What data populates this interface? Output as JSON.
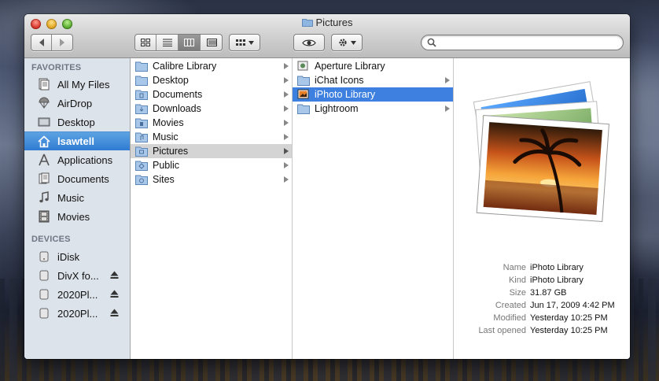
{
  "window": {
    "title": "Pictures"
  },
  "toolbar": {
    "view_modes": [
      "icon-view",
      "list-view",
      "column-view",
      "coverflow-view"
    ],
    "arrange_label": "arrange",
    "search": {
      "value": "",
      "placeholder": ""
    }
  },
  "sidebar": {
    "favorites_header": "FAVORITES",
    "favorites": [
      {
        "label": "All My Files",
        "icon": "all-files-icon"
      },
      {
        "label": "AirDrop",
        "icon": "airdrop-icon"
      },
      {
        "label": "Desktop",
        "icon": "desktop-icon"
      },
      {
        "label": "lsawtell",
        "icon": "home-icon",
        "selected": true
      },
      {
        "label": "Applications",
        "icon": "applications-icon"
      },
      {
        "label": "Documents",
        "icon": "documents-icon"
      },
      {
        "label": "Music",
        "icon": "music-icon"
      },
      {
        "label": "Movies",
        "icon": "movies-icon"
      }
    ],
    "devices_header": "DEVICES",
    "devices": [
      {
        "label": "iDisk",
        "icon": "idisk-icon",
        "eject": false
      },
      {
        "label": "DivX fo...",
        "icon": "disk-icon",
        "eject": true
      },
      {
        "label": "2020Pl...",
        "icon": "disk-icon",
        "eject": true
      },
      {
        "label": "2020Pl...",
        "icon": "disk-icon",
        "eject": true
      }
    ]
  },
  "column1": {
    "items": [
      {
        "label": "Calibre Library"
      },
      {
        "label": "Desktop"
      },
      {
        "label": "Documents"
      },
      {
        "label": "Downloads"
      },
      {
        "label": "Movies"
      },
      {
        "label": "Music"
      },
      {
        "label": "Pictures",
        "selected": true
      },
      {
        "label": "Public"
      },
      {
        "label": "Sites"
      }
    ]
  },
  "column2": {
    "items": [
      {
        "label": "Aperture Library",
        "arrow": false
      },
      {
        "label": "iChat Icons",
        "arrow": true
      },
      {
        "label": "iPhoto Library",
        "arrow": false,
        "selected": true
      },
      {
        "label": "Lightroom",
        "arrow": true
      }
    ]
  },
  "preview": {
    "info": [
      {
        "key": "Name",
        "value": "iPhoto Library"
      },
      {
        "key": "Kind",
        "value": "iPhoto Library"
      },
      {
        "key": "Size",
        "value": "31.87 GB"
      },
      {
        "key": "Created",
        "value": "Jun 17, 2009 4:42 PM"
      },
      {
        "key": "Modified",
        "value": "Yesterday 10:25 PM"
      },
      {
        "key": "Last opened",
        "value": "Yesterday 10:25 PM"
      }
    ]
  },
  "colors": {
    "selection_blue": "#3d80df",
    "sidebar_bg": "#dde3ea",
    "sidebar_selected": "#2f7bd2"
  }
}
